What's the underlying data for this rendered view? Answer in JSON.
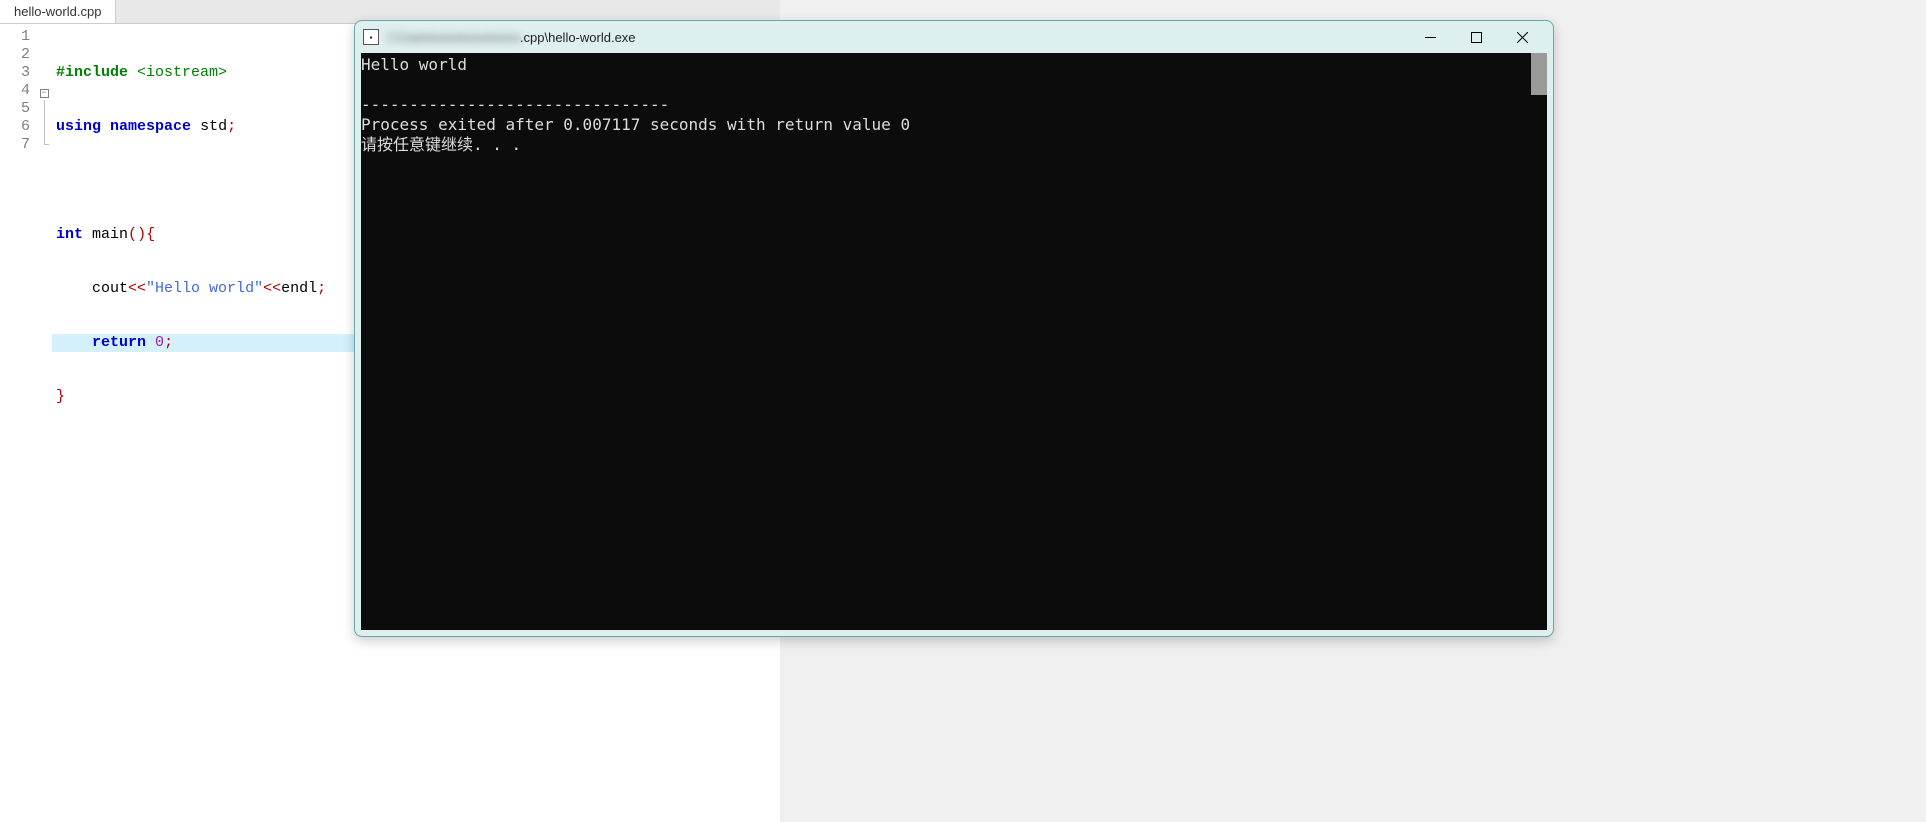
{
  "editor": {
    "tab_name": "hello-world.cpp",
    "line_numbers": [
      "1",
      "2",
      "3",
      "4",
      "5",
      "6",
      "7"
    ],
    "highlighted_line": 6,
    "code": {
      "l1_preproc": "#include",
      "l1_inc": "<iostream>",
      "l2_kw1": "using",
      "l2_kw2": "namespace",
      "l2_ident": "std",
      "l2_semi": ";",
      "l4_kw1": "int",
      "l4_ident": "main",
      "l4_paren_open": "(",
      "l4_paren_close": ")",
      "l4_brace_open": "{",
      "l5_ident1": "cout",
      "l5_op1": "<<",
      "l5_str": "\"Hello world\"",
      "l5_op2": "<<",
      "l5_ident2": "endl",
      "l5_semi": ";",
      "l6_kw": "return",
      "l6_num": "0",
      "l6_semi": ";",
      "l7_brace_close": "}"
    }
  },
  "console": {
    "title_prefix_blurred": "C:\\Users\\xxxxx\\xxxxx\\xxxxx",
    "title_suffix": ".cpp\\hello-world.exe",
    "output_line1": "Hello world",
    "separator": "--------------------------------",
    "exit_line": "Process exited after 0.007117 seconds with return value 0",
    "continue_line": "请按任意键继续. . ."
  }
}
